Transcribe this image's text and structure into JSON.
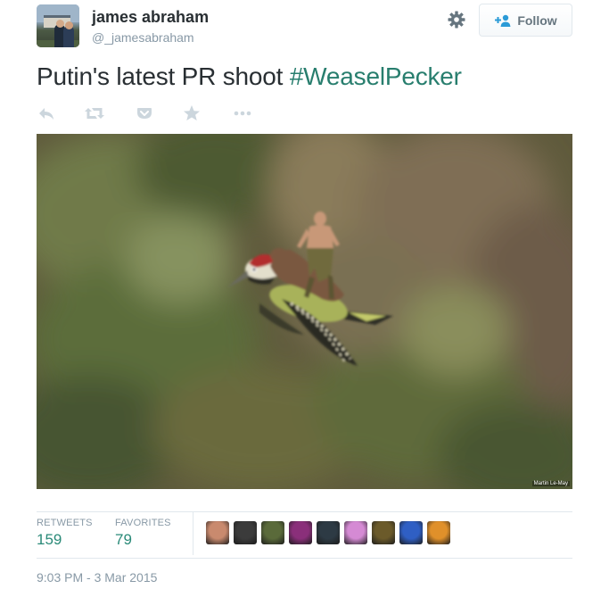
{
  "user": {
    "name": "james abraham",
    "handle": "@_jamesabraham"
  },
  "follow_button": {
    "label": "Follow"
  },
  "tweet": {
    "text": "Putin's latest PR shoot ",
    "hashtag": "#WeaselPecker"
  },
  "actions": [
    {
      "icon": "reply-icon"
    },
    {
      "icon": "retweet-icon"
    },
    {
      "icon": "pocket-icon"
    },
    {
      "icon": "favorite-star-icon"
    },
    {
      "icon": "more-icon"
    }
  ],
  "photo": {
    "credit": "Martin Le-May"
  },
  "stats": {
    "retweets_label": "RETWEETS",
    "retweets_value": "159",
    "favorites_label": "FAVORITES",
    "favorites_value": "79"
  },
  "favoriters": [
    {
      "color": "#c98a6e"
    },
    {
      "color": "#3b3b3b"
    },
    {
      "color": "#5a6a3a"
    },
    {
      "color": "#8a2f7a"
    },
    {
      "color": "#2d3a44"
    },
    {
      "color": "#d58ad4"
    },
    {
      "color": "#6b5a2a"
    },
    {
      "color": "#2f5fc4"
    },
    {
      "color": "#e0902a"
    }
  ],
  "timestamp": "9:03 PM - 3 Mar 2015",
  "colors": {
    "hashtag": "#287e6e",
    "stat_value": "#2a8a78",
    "muted": "#8899a6",
    "text": "#292f33"
  }
}
